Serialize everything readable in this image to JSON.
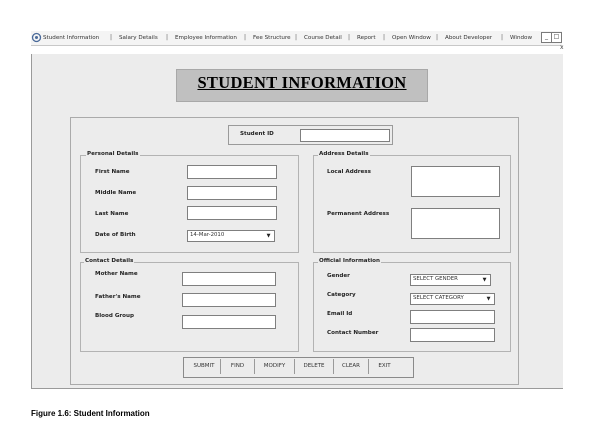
{
  "menu": {
    "items": [
      "Student Information",
      "Salary Details",
      "Employee Information",
      "Fee Structure",
      "Course Detail",
      "Report",
      "Open Window",
      "About Developer",
      "Window"
    ],
    "separator": "|",
    "window_controls": [
      "_",
      "□"
    ],
    "close_label": "x"
  },
  "title": "STUDENT INFORMATION",
  "student_id": {
    "label": "Student ID",
    "value": ""
  },
  "personal": {
    "legend": "Personal Details",
    "first_name_label": "First Name",
    "middle_name_label": "Middle Name",
    "last_name_label": "Last Name",
    "dob_label": "Date of Birth",
    "dob_value": "14-Mar-2010"
  },
  "address": {
    "legend": "Address Details",
    "local_label": "Local Address",
    "permanent_label": "Permanent Address"
  },
  "contact": {
    "legend": "Contact Details",
    "mother_label": "Mother Name",
    "father_label": "Father's Name",
    "blood_label": "Blood Group"
  },
  "official": {
    "legend": "Official Information",
    "gender_label": "Gender",
    "gender_value": "SELECT GENDER",
    "category_label": "Category",
    "category_value": "SELECT CATEGORY",
    "email_label": "Email Id",
    "contact_label": "Contact Number"
  },
  "buttons": {
    "submit": "SUBMIT",
    "find": "FIND",
    "modify": "MODIFY",
    "delete": "DELETE",
    "clear": "CLEAR",
    "exit": "EXIT"
  },
  "caption": "Figure 1.6: Student Information"
}
